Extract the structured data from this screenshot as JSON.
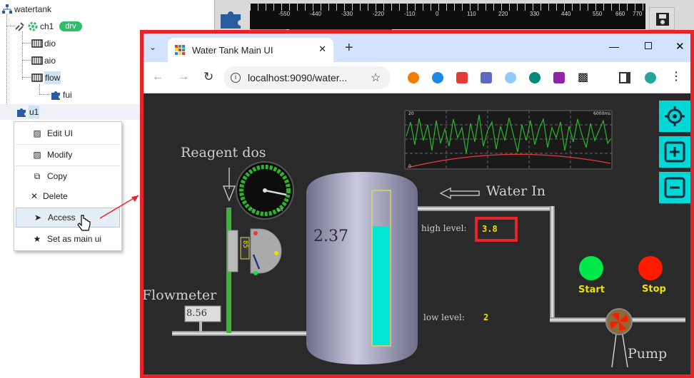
{
  "tree": {
    "root": "watertank",
    "ch1": "ch1",
    "ch1_badge": "drv",
    "dio": "dio",
    "aio": "aio",
    "flow": "flow",
    "fui": "fui",
    "u1": "u1"
  },
  "context_menu": {
    "items": [
      "Edit UI",
      "Modify",
      "Copy",
      "Delete",
      "Access",
      "Set as main ui"
    ]
  },
  "ruler": {
    "labels": [
      "-550",
      "-440",
      "-330",
      "-220",
      "-110",
      "0",
      "110",
      "220",
      "330",
      "440",
      "550",
      "660",
      "770"
    ]
  },
  "browser": {
    "tab_title": "Water Tank Main UI",
    "url": "localhost:9090/water..."
  },
  "scada": {
    "reagent_label": "Reagent dos",
    "water_in_label": "Water In",
    "flowmeter_label": "Flowmeter",
    "flowmeter_value": "8.56",
    "tank_value": "2.37",
    "high_level_label": "high level:",
    "high_level_value": "3.8",
    "low_level_label": "low  level:",
    "low_level_value": "2",
    "start_label": "Start",
    "stop_label": "Stop",
    "pump_label": "Pump",
    "dosing_value": "85",
    "tank_fill_fraction": 0.77,
    "gauge_ticks": [
      "0",
      "10",
      "20",
      "30",
      "40",
      "50",
      "60",
      "70",
      "80",
      "90",
      "100"
    ],
    "trend_top_left": "20",
    "trend_bottom_left": "0",
    "trend_top_right": "6000ms"
  },
  "colors": {
    "highlight_frame": "#e8232a",
    "cyan": "#00d8d8",
    "start": "#00e84a",
    "stop": "#ff1a00",
    "label_yellow": "#f0e000"
  }
}
